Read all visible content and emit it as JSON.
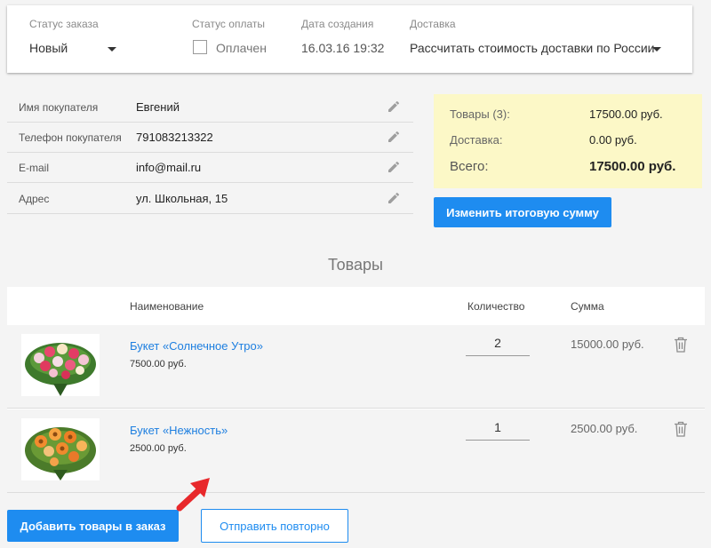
{
  "header": {
    "order_status_label": "Статус заказа",
    "order_status_value": "Новый",
    "payment_status_label": "Статус оплаты",
    "payment_checkbox_label": "Оплачен",
    "payment_checked": false,
    "created_label": "Дата создания",
    "created_value": "16.03.16 19:32",
    "delivery_label": "Доставка",
    "delivery_value": "Рассчитать стоимость доставки по России"
  },
  "customer": {
    "rows": [
      {
        "label": "Имя покупателя",
        "value": "Евгений"
      },
      {
        "label": "Телефон покупателя",
        "value": "791083213322"
      },
      {
        "label": "E-mail",
        "value": "info@mail.ru"
      },
      {
        "label": "Адрес",
        "value": "ул. Школьная, 15"
      }
    ]
  },
  "summary": {
    "items_label": "Товары (3):",
    "items_value": "17500.00 руб.",
    "delivery_label": "Доставка:",
    "delivery_value": "0.00 руб.",
    "total_label": "Всего:",
    "total_value": "17500.00 руб.",
    "change_total_button": "Изменить итоговую сумму"
  },
  "products": {
    "title": "Товары",
    "col_name": "Наименование",
    "col_qty": "Количество",
    "col_sum": "Сумма",
    "rows": [
      {
        "name": "Букет «Солнечное Утро»",
        "price": "7500.00 руб.",
        "qty": "2",
        "sum": "15000.00 руб."
      },
      {
        "name": "Букет «Нежность»",
        "price": "2500.00 руб.",
        "qty": "1",
        "sum": "2500.00 руб."
      }
    ]
  },
  "actions": {
    "add_products_button": "Добавить товары в заказ",
    "resend_button": "Отправить повторно"
  },
  "colors": {
    "accent": "#1e8cf0",
    "summary_bg": "#fcf8c7",
    "link": "#1e7fe0",
    "arrow": "#e8282b"
  }
}
